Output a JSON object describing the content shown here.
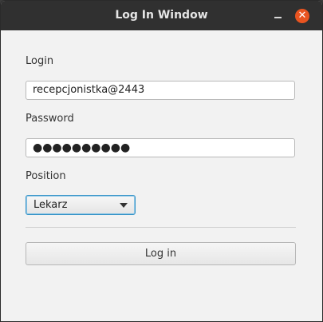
{
  "window": {
    "title": "Log In Window",
    "close_glyph": "✕"
  },
  "form": {
    "login_label": "Login",
    "login_value": "recepcjonistka@2443",
    "password_label": "Password",
    "password_value": "●●●●●●●●●●",
    "position_label": "Position",
    "position_selected": "Lekarz",
    "submit_label": "Log in"
  },
  "icons": {
    "minimize": "minimize-icon",
    "close": "close-icon",
    "dropdown": "chevron-down-icon"
  },
  "colors": {
    "titlebar": "#303030",
    "close_button": "#e95420",
    "focus_border": "#3a96c9",
    "background": "#f2f2f2"
  }
}
